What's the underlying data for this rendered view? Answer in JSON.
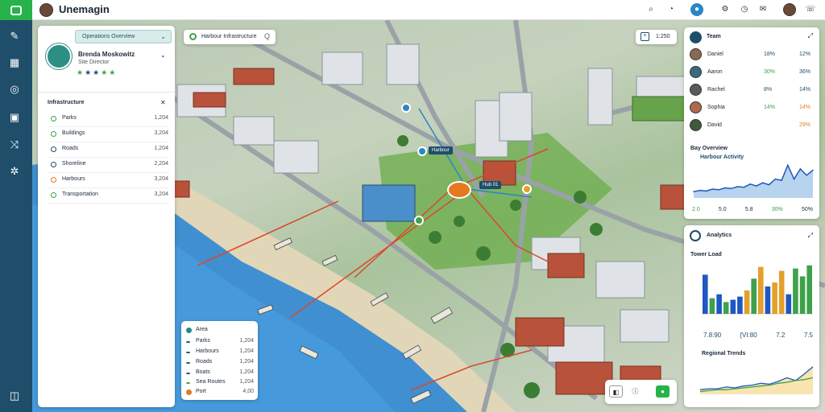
{
  "app": {
    "title": "Unemagin"
  },
  "topbar": {
    "icons": [
      "search-icon",
      "bulb-icon",
      "notification-icon",
      "settings-icon",
      "user-icon",
      "phone-icon"
    ],
    "badge": "0"
  },
  "left_panel": {
    "dropdown": "Operations Overview",
    "profile": {
      "name": "Brenda Moskowitz",
      "role": "Site Director",
      "rating": 5
    },
    "section_title": "Infrastructure",
    "layers": [
      {
        "label": "Parks",
        "value": "1,204",
        "color": "#3ea14b"
      },
      {
        "label": "Buildings",
        "value": "3,204",
        "color": "#3ea14b"
      },
      {
        "label": "Roads",
        "value": "1,204",
        "color": "#1f4e6b"
      },
      {
        "label": "Shoreline",
        "value": "2,204",
        "color": "#1f4e6b"
      },
      {
        "label": "Harbours",
        "value": "3,204",
        "color": "#e4791f"
      },
      {
        "label": "Transportation",
        "value": "3,204",
        "color": "#3ea14b"
      }
    ]
  },
  "search": {
    "text": "Harbour Infrastructure",
    "end": "Q"
  },
  "zoom": {
    "value": "1:250"
  },
  "map": {
    "marker_label": "Harbour",
    "hub_label": "Hub 01"
  },
  "team_panel": {
    "title": "Team",
    "members": [
      {
        "name": "Daniel",
        "s1": "18%",
        "s2": "12%",
        "s1_color": "#1f4e6b",
        "s2_color": "#1f4e6b"
      },
      {
        "name": "Aaron",
        "s1": "30%",
        "s2": "36%",
        "s1_color": "#3ea14b",
        "s2_color": "#1f4e6b"
      },
      {
        "name": "Rachel",
        "s1": "8%",
        "s2": "14%",
        "s1_color": "#1f4e6b",
        "s2_color": "#1f4e6b"
      },
      {
        "name": "Sophia",
        "s1": "14%",
        "s2": "14%",
        "s1_color": "#3ea14b",
        "s2_color": "#e4791f"
      },
      {
        "name": "David",
        "s1": "",
        "s2": "29%",
        "s1_color": "#1f4e6b",
        "s2_color": "#e4791f"
      }
    ],
    "chart_title": "Bay Overview",
    "chart_sub": "Harbour Activity",
    "chart_footer": [
      "2.0",
      "5.0",
      "5.8",
      "30%",
      "50%"
    ]
  },
  "bars_panel": {
    "title": "Analytics",
    "chart_title": "Tower Load",
    "legend_values": [
      "7.8:90",
      "[VI:80",
      "7.2",
      "7.5"
    ],
    "area_title": "Regional Trends"
  },
  "legend": {
    "rows": [
      {
        "label": "Area",
        "value": "",
        "color": "#1f4e6b"
      },
      {
        "label": "Parks",
        "value": "1,204",
        "color": "#1f4e6b"
      },
      {
        "label": "Harbours",
        "value": "1,204",
        "color": "#1f4e6b"
      },
      {
        "label": "Roads",
        "value": "1,204",
        "color": "#1f4e6b"
      },
      {
        "label": "Boats",
        "value": "1,204",
        "color": "#1f4e6b"
      },
      {
        "label": "Sea Routes",
        "value": "1,204",
        "color": "#3ea14b"
      },
      {
        "label": "Port",
        "value": "4,00",
        "color": "#e4791f"
      }
    ]
  },
  "chart_data": [
    {
      "type": "area",
      "x": [
        1,
        2,
        3,
        4,
        5,
        6,
        7,
        8,
        9,
        10,
        11,
        12,
        13,
        14,
        15,
        16,
        17,
        18,
        19,
        20
      ],
      "values": [
        10,
        12,
        11,
        14,
        13,
        16,
        15,
        18,
        17,
        22,
        19,
        24,
        21,
        30,
        28,
        52,
        30,
        46,
        36,
        44
      ],
      "ylim": [
        0,
        60
      ]
    },
    {
      "type": "bar",
      "series": [
        {
          "name": "A",
          "values": [
            50,
            20,
            25,
            15,
            18,
            22,
            30,
            45,
            60,
            35,
            40,
            55,
            25,
            58,
            48,
            62
          ],
          "colors": [
            "#1f57c3",
            "#3ea14b",
            "#1f57c3",
            "#3ea14b",
            "#1f57c3",
            "#1f57c3",
            "#e4a02a",
            "#3ea14b",
            "#e4a02a",
            "#1f57c3",
            "#e4a02a",
            "#e4a02a",
            "#1f57c3",
            "#3ea14b",
            "#3ea14b",
            "#3ea14b"
          ]
        }
      ],
      "ylim": [
        0,
        70
      ]
    },
    {
      "type": "line",
      "series": [
        {
          "values": [
            5,
            6,
            6,
            8,
            7,
            9,
            10,
            12,
            11,
            14,
            18,
            15,
            22,
            30
          ]
        },
        {
          "values": [
            3,
            4,
            5,
            5,
            6,
            7,
            8,
            9,
            10,
            12,
            13,
            15,
            16,
            18
          ]
        }
      ],
      "ylim": [
        0,
        35
      ]
    }
  ]
}
